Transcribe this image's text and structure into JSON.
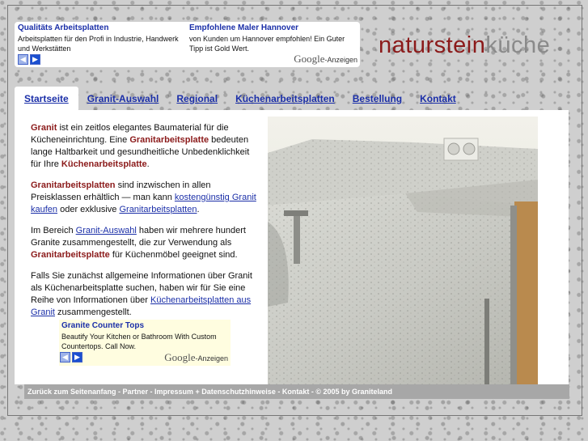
{
  "ads_top": [
    {
      "title": "Qualitäts Arbeitsplatten",
      "text": "Arbeitsplatten für den Profi in Industrie, Handwerk und Werkstätten"
    },
    {
      "title": "Empfohlene Maler Hannover",
      "text": "von Kunden um Hannover empfohlen! Ein Guter Tipp ist Gold Wert."
    }
  ],
  "google_badge": {
    "logo": "Google",
    "suffix": "-Anzeigen"
  },
  "nav_icons": {
    "prev": "◀",
    "next": "▶"
  },
  "logo": {
    "part1": "naturstein",
    "part2": "küche"
  },
  "tabs": [
    "Startseite",
    "Granit-Auswahl",
    "Regional",
    "Küchenarbeitsplatten",
    "Bestellung",
    "Kontakt"
  ],
  "content": {
    "p1": {
      "hl1": "Granit",
      "t1": " ist ein zeitlos elegantes Baumaterial für die Kücheneinrichtung. Eine ",
      "hl2": "Granitarbeitsplatte",
      "t2": " bedeuten lange Haltbarkeit und gesundheitliche Unbedenklichkeit für Ihre ",
      "hl3": "Küchenarbeitsplatte",
      "t3": "."
    },
    "p2": {
      "hl1": "Granitarbeitsplatten",
      "t1": " sind inzwischen in allen Preisklassen erhältlich — man kann ",
      "link1": "kostengünstig Granit kaufen",
      "t2": " oder exklusive ",
      "link2": "Granitarbeitsplatten",
      "t3": "."
    },
    "p3": {
      "t1": "Im Bereich ",
      "link1": "Granit-Auswahl",
      "t2": " haben wir mehrere hundert Granite zusammengestellt, die zur Verwendung als ",
      "hl1": "Granitarbeitsplatte",
      "t3": " für Küchenmöbel geeignet sind."
    },
    "p4": {
      "t1": "Falls Sie zunächst allgemeine Informationen über Granit als Küchenarbeitsplatte suchen, haben wir für Sie eine Reihe von Informationen über ",
      "link1": "Küchenarbeitsplatten aus Granit",
      "t2": " zusammengestellt."
    }
  },
  "ad_bottom": {
    "title": "Granite Counter Tops",
    "text": "Beautify Your Kitchen or Bathroom With Custom Countertops. Call Now."
  },
  "footer": "Zurück zum Seitenanfang - Partner - Impressum + Datenschutzhinweise - Kontakt - © 2005 by Graniteland",
  "colors": {
    "accent": "#8b1a1a",
    "link": "#1b2fa8",
    "footer_bg": "#a7a7a7"
  }
}
